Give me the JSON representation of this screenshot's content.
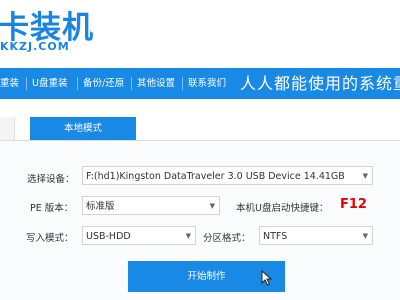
{
  "logo": {
    "name": "卡装机",
    "url": "KKZJ.COM"
  },
  "nav": {
    "items": [
      "重装",
      "U盘重装",
      "备份/还原",
      "其他设置",
      "联系我们"
    ],
    "slogan": "人人都能使用的系统重"
  },
  "tabs": {
    "active": "本地模式"
  },
  "form": {
    "device": {
      "label": "选择设备：",
      "value": "F:(hd1)Kingston DataTraveler 3.0 USB Device 14.41GB"
    },
    "pe": {
      "label": "PE 版本：",
      "value": "标准版"
    },
    "hotkey": {
      "label": "本机U盘启动快捷键：",
      "value": "F12"
    },
    "write": {
      "label": "写入模式：",
      "value": "USB-HDD"
    },
    "partition": {
      "label": "分区格式：",
      "value": "NTFS"
    }
  },
  "actions": {
    "start": "开始制作"
  },
  "colors": {
    "accent": "#1989e6",
    "hotkey": "#e60000"
  }
}
